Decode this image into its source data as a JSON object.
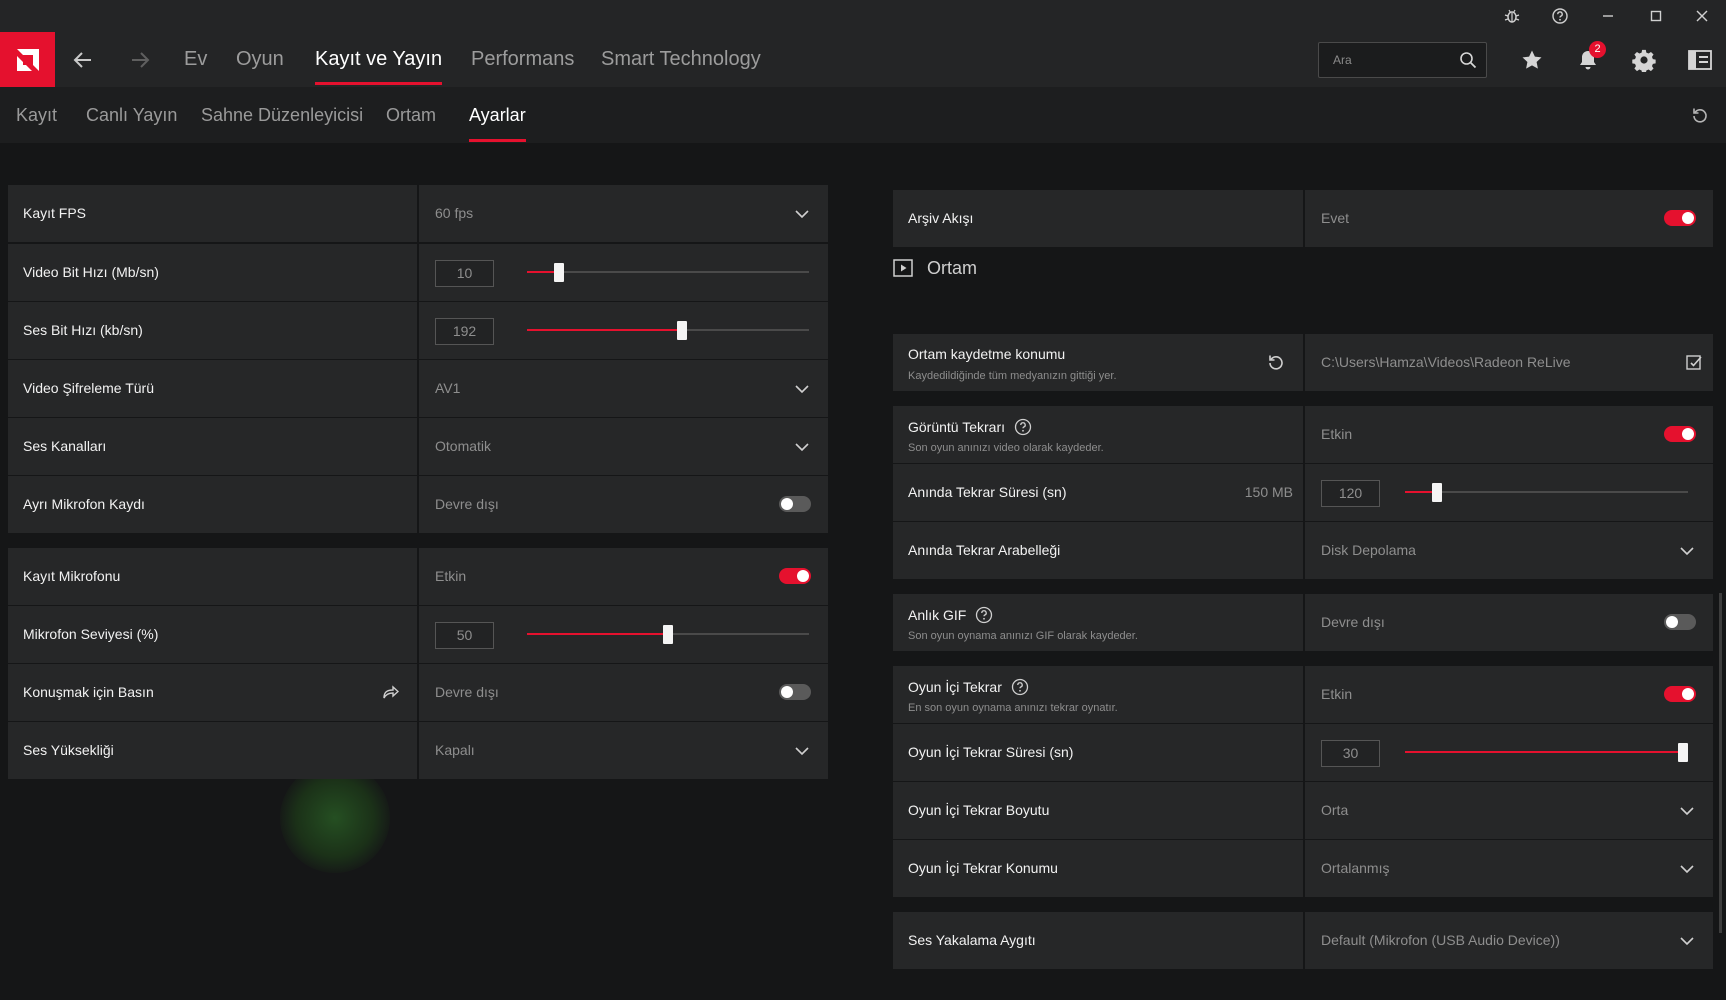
{
  "colors": {
    "accent": "#e5112e",
    "panel": "#262728",
    "background": "#151617"
  },
  "window": {
    "icons": [
      "bug-icon",
      "help-icon",
      "minimize-icon",
      "maximize-icon",
      "close-icon"
    ]
  },
  "main_nav": {
    "tabs": [
      {
        "label": "Ev"
      },
      {
        "label": "Oyun"
      },
      {
        "label": "Kayıt ve Yayın",
        "active": true
      },
      {
        "label": "Performans"
      },
      {
        "label": "Smart Technology"
      }
    ],
    "search": {
      "placeholder": "Ara"
    },
    "notifications_count": "2"
  },
  "sub_nav": {
    "tabs": [
      {
        "label": "Kayıt"
      },
      {
        "label": "Canlı Yayın"
      },
      {
        "label": "Sahne Düzenleyicisi"
      },
      {
        "label": "Ortam"
      },
      {
        "label": "Ayarlar",
        "active": true
      }
    ]
  },
  "left": {
    "rows": [
      {
        "label": "Kayıt FPS",
        "value": "60 fps",
        "control": "dropdown"
      },
      {
        "label": "Video Bit Hızı (Mb/sn)",
        "value": "10",
        "control": "slider",
        "level": 0.1
      },
      {
        "label": "Ses Bit Hızı (kb/sn)",
        "value": "192",
        "control": "slider",
        "level": 0.55
      },
      {
        "label": "Video Şifreleme Türü",
        "value": "AV1",
        "control": "dropdown"
      },
      {
        "label": "Ses Kanalları",
        "value": "Otomatik",
        "control": "dropdown"
      },
      {
        "label": "Ayrı Mikrofon Kaydı",
        "value": "Devre dışı",
        "control": "toggle",
        "on": false
      },
      {
        "label": "Kayıt Mikrofonu",
        "value": "Etkin",
        "control": "toggle",
        "on": true
      },
      {
        "label": "Mikrofon Seviyesi (%)",
        "value": "50",
        "control": "slider",
        "level": 0.5
      },
      {
        "label": "Konuşmak için Basın",
        "value": "Devre dışı",
        "control": "toggle",
        "on": false
      },
      {
        "label": "Ses Yüksekliği",
        "value": "Kapalı",
        "control": "dropdown"
      }
    ]
  },
  "right": {
    "archive": {
      "label": "Arşiv Akışı",
      "value": "Evet",
      "on": true
    },
    "section_title": "Ortam",
    "media_location": {
      "label": "Ortam kaydetme konumu",
      "desc": "Kaydedildiğinde tüm medyanızın gittiği yer.",
      "path": "C:\\Users\\Hamza\\Videos\\Radeon ReLive"
    },
    "instant_replay": {
      "label": "Görüntü Tekrarı",
      "desc": "Son oyun anınızı video olarak kaydeder.",
      "value": "Etkin",
      "on": true
    },
    "instant_replay_duration": {
      "label": "Anında Tekrar Süresi (sn)",
      "size": "150 MB",
      "value": "120",
      "level": 0.1
    },
    "instant_replay_buffer": {
      "label": "Anında Tekrar Arabelleği",
      "value": "Disk Depolama"
    },
    "instant_gif": {
      "label": "Anlık GIF",
      "desc": "Son oyun oynama anınızı GIF olarak kaydeder.",
      "value": "Devre dışı",
      "on": false
    },
    "in_game_replay": {
      "label": "Oyun İçi Tekrar",
      "desc": "En son oyun oynama anınızı tekrar oynatır.",
      "value": "Etkin",
      "on": true
    },
    "in_game_replay_duration": {
      "label": "Oyun İçi Tekrar Süresi (sn)",
      "value": "30",
      "level": 1.0
    },
    "in_game_replay_size": {
      "label": "Oyun İçi Tekrar Boyutu",
      "value": "Orta"
    },
    "in_game_replay_position": {
      "label": "Oyun İçi Tekrar Konumu",
      "value": "Ortalanmış"
    },
    "audio_capture_device": {
      "label": "Ses Yakalama Aygıtı",
      "value": "Default (Mikrofon (USB Audio Device))"
    }
  }
}
